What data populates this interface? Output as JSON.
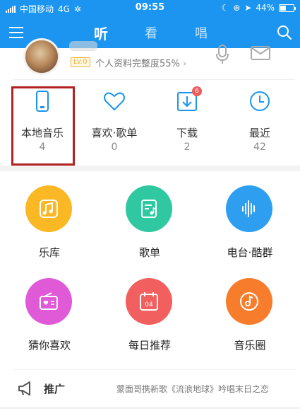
{
  "status_bar": {
    "carrier": "中国移动",
    "network": "4G",
    "time": "09:55",
    "battery": "44%",
    "battery_level": 0.44
  },
  "nav": {
    "tabs": [
      {
        "label": "听",
        "active": true
      },
      {
        "label": "看",
        "active": false
      },
      {
        "label": "唱",
        "active": false
      }
    ]
  },
  "profile": {
    "level_badge": "LV.0",
    "completeness": "个人资料完整度55%"
  },
  "quick_items": [
    {
      "label": "本地音乐",
      "count": "4",
      "icon": "phone-icon"
    },
    {
      "label": "喜欢·歌单",
      "count": "0",
      "icon": "heart-icon"
    },
    {
      "label": "下载",
      "count": "2",
      "icon": "download-icon",
      "badge": "6"
    },
    {
      "label": "最近",
      "count": "42",
      "icon": "clock-icon"
    }
  ],
  "grid": [
    {
      "label": "乐库",
      "icon": "music-note-icon",
      "color": "#f9b824"
    },
    {
      "label": "歌单",
      "icon": "songlist-icon",
      "color": "#2fc8a0"
    },
    {
      "label": "电台·酷群",
      "icon": "radio-wave-icon",
      "color": "#2e9ff0"
    },
    {
      "label": "猜你喜欢",
      "icon": "radio-heart-icon",
      "color": "#e05ad8"
    },
    {
      "label": "每日推荐",
      "icon": "calendar-icon",
      "color": "#f25f5f"
    },
    {
      "label": "音乐圈",
      "icon": "music-disc-icon",
      "color": "#f77c2c"
    }
  ],
  "promo": {
    "label": "推广",
    "text": "蒙面哥携新歌《流浪地球》吟唱末日之恋"
  },
  "colors": {
    "primary": "#1b95ef",
    "highlight_border": "#b22222"
  }
}
